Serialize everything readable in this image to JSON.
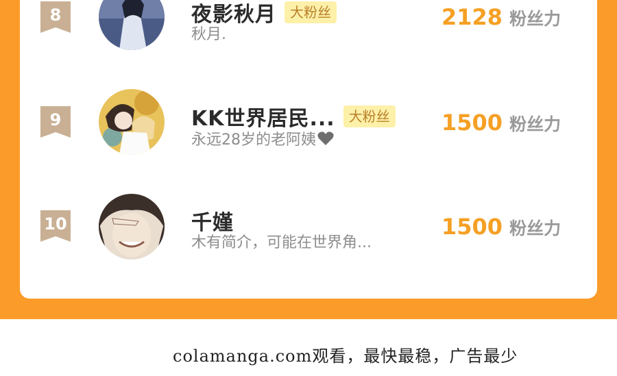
{
  "leaderboard": {
    "rows": [
      {
        "rank": "8",
        "name": "夜影秋月",
        "badge": "大粉丝",
        "bio": "秋月.",
        "score": "2128",
        "unit": "粉丝力",
        "avatar_icon": "avatar-user-icon"
      },
      {
        "rank": "9",
        "name": "KK世界居民...",
        "badge": "大粉丝",
        "bio": "永远28岁的老阿姨",
        "score": "1500",
        "unit": "粉丝力",
        "avatar_icon": "avatar-user-icon"
      },
      {
        "rank": "10",
        "name": "千嫤",
        "bio": "木有简介，可能在世界角...",
        "score": "1500",
        "unit": "粉丝力",
        "avatar_icon": "avatar-user-icon"
      }
    ]
  },
  "footer": {
    "text": "colamanga.com观看，最快最稳，广告最少"
  },
  "colors": {
    "accent_orange": "#fb9b2a",
    "score_orange": "#f5a024",
    "rank_badge": "#c9b094",
    "fan_badge_bg": "#fdf0a8"
  }
}
